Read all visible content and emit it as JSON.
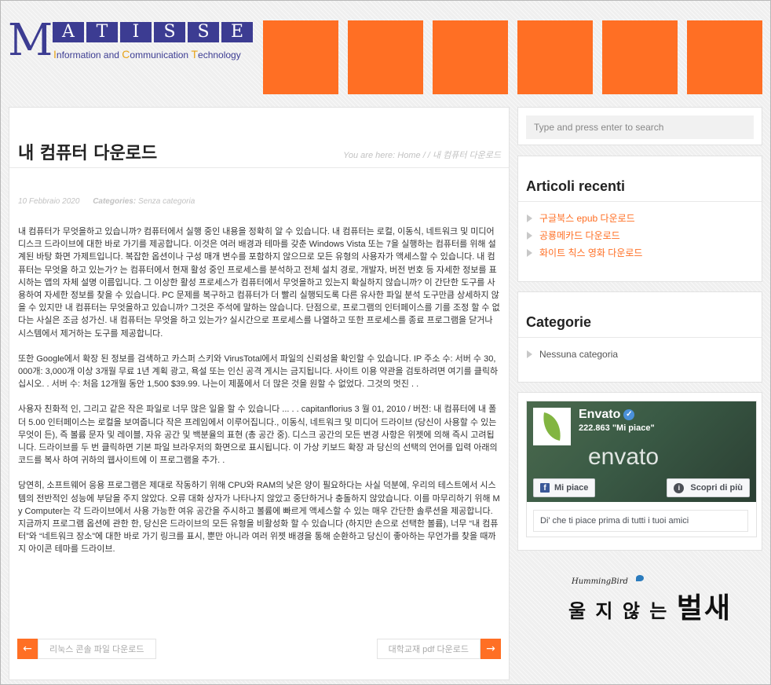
{
  "logo": {
    "initial": "M",
    "letters": [
      "A",
      "T",
      "I",
      "S",
      "S",
      "E"
    ],
    "subtitle_parts": [
      {
        "cap": "I",
        "rest": "nformation and "
      },
      {
        "cap": "C",
        "rest": "ommunication "
      },
      {
        "cap": "T",
        "rest": "echnology"
      }
    ],
    "colors": {
      "primary": "#3c3c92",
      "accent": "#e8a317"
    }
  },
  "header_tiles": {
    "count": 6,
    "color": "#ff6f24"
  },
  "post": {
    "title": "내 컴퓨터 다운로드",
    "breadcrumb": {
      "prefix": "You are here:",
      "home": "Home",
      "sep": "/ /",
      "current": "내 컴퓨터 다운로드"
    },
    "date": "10 Febbraio 2020",
    "categories_label": "Categories:",
    "category": "Senza categoria",
    "paragraphs": [
      "내 컴퓨터가 무엇을하고 있습니까? 컴퓨터에서 실행 중인 내용을 정확히 알 수 있습니다. 내 컴퓨터는 로컬, 이동식, 네트워크 및 미디어 디스크 드라이브에 대한 바로 가기를 제공합니다. 이것은 여러 배경과 테마를 갖춘 Windows Vista 또는 7을 실행하는 컴퓨터를 위해 설계된 바탕 화면 가제트입니다. 복잡한 옵션이나 구성 매개 변수를 포함하지 않으므로 모든 유형의 사용자가 액세스할 수 있습니다. 내 컴퓨터는 무엇을 하고 있는가? 는 컴퓨터에서 현재 활성 중인 프로세스를 분석하고 전체 설치 경로, 개발자, 버전 번호 등 자세한 정보를 표시하는 앱의 자체 설명 이름입니다. 그 이상한 활성 프로세스가 컴퓨터에서 무엇을하고 있는지 확실하지 않습니까? 이 간단한 도구를 사용하여 자세한 정보를 찾을 수 있습니다. PC 문제를 복구하고 컴퓨터가 더 빨리 실행되도록 다른 유사한 파일 분석 도구만큼 상세하지 않을 수 있지만 내 컴퓨터는 무엇을하고 있습니까? 그것은 주석에 말하는 않습니다. 단점으로, 프로그램의 인터페이스를 기를 조정 할 수 없다는 사실은 조금 성가신. 내 컴퓨터는 무엇을 하고 있는가? 실시간으로 프로세스를 나열하고 또한 프로세스를 종료 프로그램을 닫거나 시스템에서 제거하는 도구를 제공합니다.",
      "또한 Google에서 확장 된 정보를 검색하고 카스퍼 스키와 VirusTotal에서 파일의 신뢰성을 확인할 수 있습니다. IP 주소 수: 서버 수 30,000개: 3,000개 이상 3개월 무료 1년 계획 광고, 욕설 또는 인신 공격 게시는 금지됩니다. 사이트 이용 약관을 검토하려면 여기를 클릭하십시오. . 서버 수: 처음 12개월 동안 1,500 $39.99. 나는이 제품에서 더 많은 것을 원할 수 없었다. 그것의 멋진 . .",
      "사용자 친화적 인, 그리고 같은 작은 파일로 너무 많은 일을 할 수 있습니다 ... . . capitanflorius 3 월 01, 2010 / 버전: 내 컴퓨터에 내 폴더 5.00 인터페이스는 로컬을 보여줍니다 작은 프레임에서 이루어집니다., 이동식, 네트워크 및 미디어 드라이브 (당신이 사용할 수 있는 무엇이 든), 즉 볼륨 문자 및 레이블, 자유 공간 및 백분율의 표현 (총 공간 중). 디스크 공간의 모든 변경 사항은 위젯에 의해 즉시 고려됩니다. 드라이브를 두 번 클릭하면 기본 파일 브라우저의 화면으로 표시됩니다. 이 가상 키보드 확장 과 당신의 선택의 언어를 입력 아래의 코드를 복사 하여 귀하의 웹사이트에 이 프로그램을 추가. .",
      "당연히, 소프트웨어 응용 프로그램은 제대로 작동하기 위해 CPU와 RAM의 낮은 양이 필요하다는 사실 덕분에, 우리의 테스트에서 시스템의 전반적인 성능에 부담을 주지 않았다. 오류 대화 상자가 나타나지 않았고 중단하거나 충돌하지 않았습니다. 이를 마무리하기 위해 My Computer는 각 드라이브에서 사용 가능한 여유 공간을 주시하고 볼륨에 빠르게 액세스할 수 있는 매우 간단한 솔루션을 제공합니다. 지금까지 프로그램 옵션에 관한 한, 당신은 드라이브의 모든 유형을 비활성화 할 수 있습니다 (하지만 손으로 선택한 볼륨), 너무 “내 컴퓨터”와 “네트워크 장소”에 대한 바로 가기 링크를 표시, 뿐만 아니라 여러 위젯 배경을 통해 순환하고 당신이 좋아하는 무언가를 찾을 때까지 아이콘 테마를 드라이브."
    ],
    "prev_link": {
      "arrow": "←",
      "label": "리눅스 콘솔 파일 다운로드"
    },
    "next_link": {
      "arrow": "→",
      "label": "대학교재 pdf 다운로드"
    }
  },
  "sidebar": {
    "search_placeholder": "Type and press enter to search",
    "recent": {
      "title": "Articoli recenti",
      "items": [
        "구글북스 epub 다운로드",
        "공룡메카드 다운로드",
        "화이트 칙스 영화 다운로드"
      ]
    },
    "categories": {
      "title": "Categorie",
      "items": [
        "Nessuna categoria"
      ]
    },
    "facebook": {
      "page_name": "Envato",
      "likes": "222.863 \"Mi piace\"",
      "wordmark": "envato",
      "like_button": "Mi piace",
      "more_button": "Scopri di più",
      "footer": "Di' che ti piace prima di tutti i tuoi amici"
    },
    "signature": {
      "small": "HummingBird",
      "main_part1": "울 지 않 는 ",
      "main_part2": "벌새"
    }
  },
  "colors": {
    "accent": "#ff6f24",
    "link": "#ff6f24"
  }
}
